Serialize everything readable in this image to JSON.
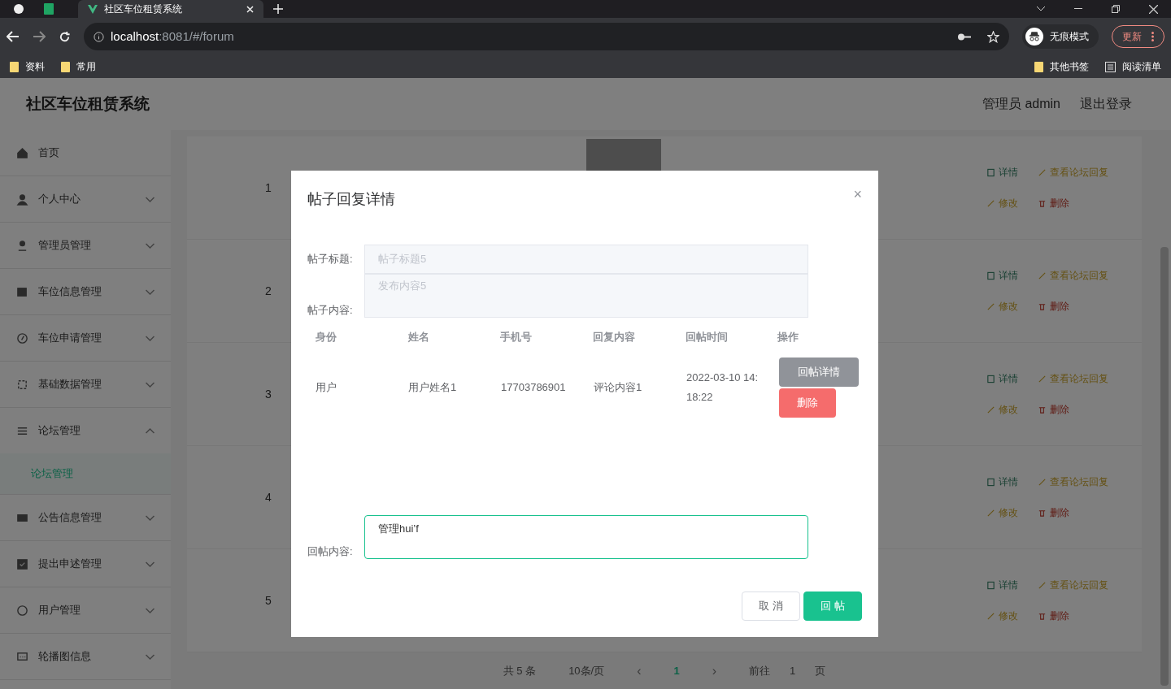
{
  "browser": {
    "tab_title": "社区车位租赁系统",
    "url_host": "localhost",
    "url_path": ":8081/#/forum",
    "profile": "无痕模式",
    "update": "更新",
    "bookmarks": [
      {
        "label": "资料",
        "kind": "folder"
      },
      {
        "label": "常用",
        "kind": "folder"
      }
    ],
    "bookmarks_right": [
      {
        "label": "其他书签",
        "kind": "folder"
      },
      {
        "label": "阅读清单",
        "kind": "list"
      }
    ]
  },
  "header": {
    "title": "社区车位租赁系统",
    "user": "管理员 admin",
    "logout": "退出登录"
  },
  "sidebar": {
    "items": [
      {
        "label": "首页"
      },
      {
        "label": "个人中心",
        "expanded": false
      },
      {
        "label": "管理员管理",
        "expanded": false
      },
      {
        "label": "车位信息管理",
        "expanded": false
      },
      {
        "label": "车位申请管理",
        "expanded": false
      },
      {
        "label": "基础数据管理",
        "expanded": false
      },
      {
        "label": "论坛管理",
        "expanded": true,
        "children": [
          {
            "label": "论坛管理",
            "selected": true
          }
        ]
      },
      {
        "label": "公告信息管理",
        "expanded": false
      },
      {
        "label": "提出申述管理",
        "expanded": false
      },
      {
        "label": "用户管理",
        "expanded": false
      },
      {
        "label": "轮播图信息",
        "expanded": false
      }
    ]
  },
  "table": {
    "rows": [
      {
        "index": "1",
        "actions": [
          {
            "label": "详情",
            "kind": "detail"
          },
          {
            "label": "查看论坛回复",
            "kind": "reply"
          },
          {
            "label": "修改",
            "kind": "edit"
          },
          {
            "label": "删除",
            "kind": "delete"
          }
        ]
      },
      {
        "index": "2",
        "actions": [
          {
            "label": "详情",
            "kind": "detail"
          },
          {
            "label": "查看论坛回复",
            "kind": "reply"
          },
          {
            "label": "修改",
            "kind": "edit"
          },
          {
            "label": "删除",
            "kind": "delete"
          }
        ]
      },
      {
        "index": "3",
        "actions": [
          {
            "label": "详情",
            "kind": "detail"
          },
          {
            "label": "查看论坛回复",
            "kind": "reply"
          },
          {
            "label": "修改",
            "kind": "edit"
          },
          {
            "label": "删除",
            "kind": "delete"
          }
        ]
      },
      {
        "index": "4",
        "actions": [
          {
            "label": "详情",
            "kind": "detail"
          },
          {
            "label": "查看论坛回复",
            "kind": "reply"
          },
          {
            "label": "修改",
            "kind": "edit"
          },
          {
            "label": "删除",
            "kind": "delete"
          }
        ]
      },
      {
        "index": "5",
        "actions": [
          {
            "label": "详情",
            "kind": "detail"
          },
          {
            "label": "查看论坛回复",
            "kind": "reply"
          },
          {
            "label": "修改",
            "kind": "edit"
          },
          {
            "label": "删除",
            "kind": "delete"
          }
        ]
      }
    ]
  },
  "pagination": {
    "total": "共 5 条",
    "page_size": "10条/页",
    "prev": "‹",
    "pages": [
      {
        "label": "1",
        "selected": true
      }
    ],
    "next": "›",
    "goto": "前往",
    "goto_value": "1",
    "goto_suffix": "页"
  },
  "dialog": {
    "title": "帖子回复详情",
    "close": "×",
    "fields": [
      {
        "label": "帖子标题:",
        "value": "帖子标题5",
        "kind": "input",
        "disabled": true
      },
      {
        "label": "帖子内容:",
        "value": "发布内容5",
        "kind": "textarea",
        "disabled": true
      }
    ],
    "columns": [
      "身份",
      "姓名",
      "手机号",
      "回复内容",
      "回帖时间",
      "操作"
    ],
    "rows": [
      {
        "cells": [
          "用户",
          "用户姓名1",
          "17703786901",
          "评论内容1",
          "2022-03-10 14:18:22"
        ],
        "actions": [
          {
            "label": "回帖详情",
            "kind": "info"
          },
          {
            "label": "删除",
            "kind": "danger"
          }
        ]
      }
    ],
    "reply": {
      "label": "回帖内容:",
      "value": "管理hui’f"
    },
    "buttons": [
      {
        "label": "取 消",
        "kind": "default"
      },
      {
        "label": "回 帖",
        "kind": "primary"
      }
    ]
  }
}
